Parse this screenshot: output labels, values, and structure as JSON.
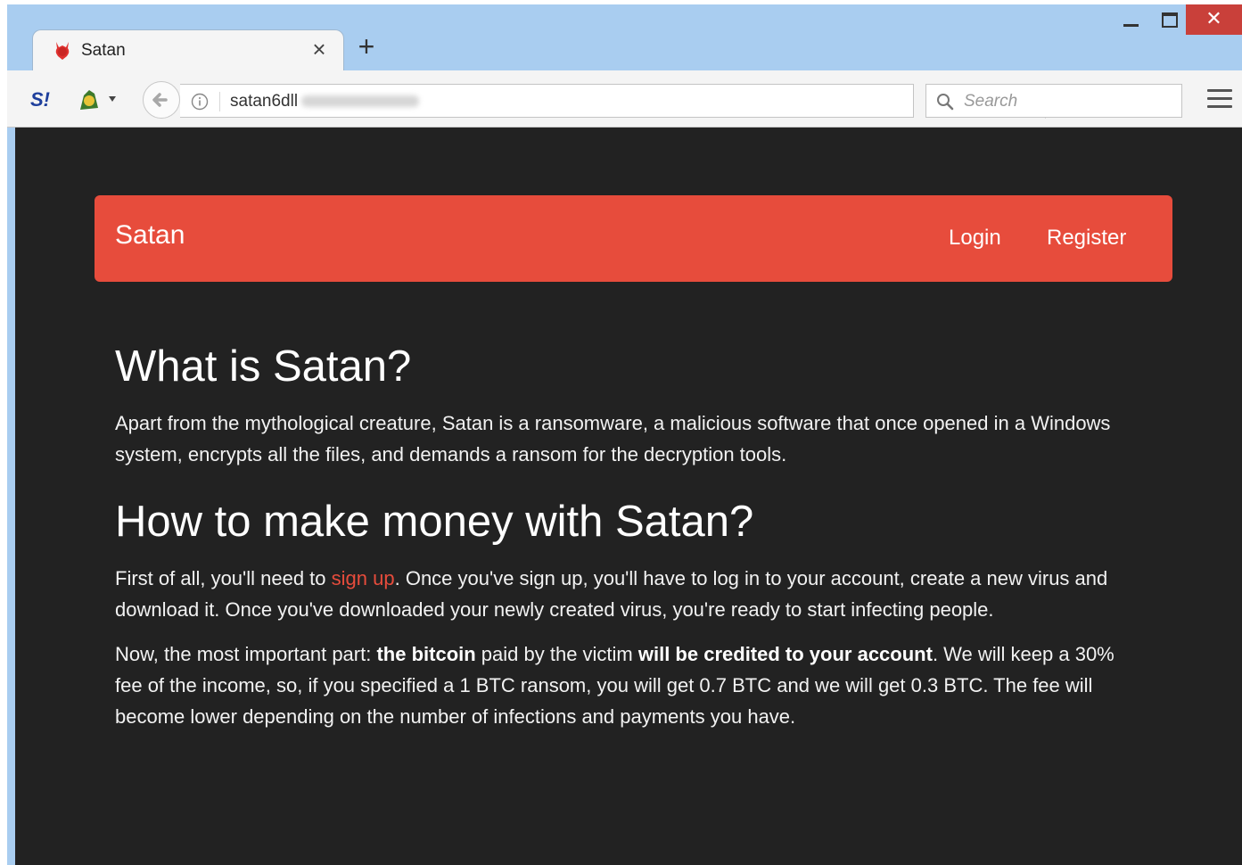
{
  "browser": {
    "tab": {
      "title": "Satan"
    },
    "url": {
      "visible_text": "satan6dll"
    },
    "search": {
      "placeholder": "Search"
    },
    "window_controls": {
      "close": "✕"
    },
    "new_tab_symbol": "+",
    "ext_label": "S!"
  },
  "page": {
    "navbar": {
      "brand": "Satan",
      "login": "Login",
      "register": "Register",
      "color": "#e74c3c"
    },
    "background": "#222222",
    "sections": {
      "what": {
        "heading": "What is Satan?",
        "paragraph": "Apart from the mythological creature, Satan is a ransomware, a malicious software that once opened in a Windows system, encrypts all the files, and demands a ransom for the decryption tools."
      },
      "how": {
        "heading": "How to make money with Satan?",
        "p1_before_link": "First of all, you'll need to ",
        "p1_link": "sign up",
        "p1_after_link": ". Once you've sign up, you'll have to log in to your account, create a new virus and download it. Once you've downloaded your newly created virus, you're ready to start infecting people.",
        "p2_part1": "Now, the most important part: ",
        "p2_bold1": "the bitcoin",
        "p2_part2": " paid by the victim ",
        "p2_bold2": "will be credited to your account",
        "p2_part3": ". We will keep a 30% fee of the income, so, if you specified a 1 BTC ransom, you will get 0.7 BTC and we will get 0.3 BTC. The fee will become lower depending on the number of infections and payments you have."
      }
    }
  }
}
